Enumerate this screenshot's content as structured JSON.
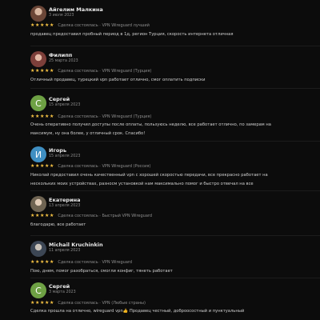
{
  "reviews": [
    {
      "name": "Айгелим Малкина",
      "date": "3 июля 2023",
      "avatar": {
        "type": "photo",
        "initial": "",
        "color": "#7a5a4a"
      },
      "rating": 5,
      "subtitle": "Сделка состоялась · VPN Wireguard лучший",
      "text": "продавец предоставил пробный период в 1д, регион Турция, скорость интернета отличная"
    },
    {
      "name": "Филипп",
      "date": "25 марта 2023",
      "avatar": {
        "type": "photo",
        "initial": "",
        "color": "#8a5a54"
      },
      "rating": 5,
      "subtitle": "Сделка состоялась · VPN Wireguard (Турция)",
      "text": "Отличный продавец, турецкий vpn работает отлично, смог оплатить подписки"
    },
    {
      "name": "Сергей",
      "date": "15 апреля 2023",
      "avatar": {
        "type": "letter",
        "initial": "С",
        "color": "#6ea144"
      },
      "rating": 5,
      "subtitle": "Сделка состоялась · VPN Wireguard (Турция)",
      "text": "Очень оперативно получил доступы после оплаты, пользуюсь неделю, все работает отлично, по замерам на максимум, ну она более, у отличный срок. Спасибо!"
    },
    {
      "name": "Игорь",
      "date": "15 апреля 2023",
      "avatar": {
        "type": "letter",
        "initial": "И",
        "color": "#3f8fc2"
      },
      "rating": 5,
      "subtitle": "Сделка состоялась · VPN Wireguard (Россия)",
      "text": "Николай предоставил очень качественный vpn с хорошей скоростью передачи, все прекрасно работает на нескольких моих устройствах, разносм установкой нам максимально помог и быстро отвечал на все"
    },
    {
      "name": "Екатерина",
      "date": "13 апреля 2023",
      "avatar": {
        "type": "photo",
        "initial": "",
        "color": "#8b7d6b"
      },
      "rating": 5,
      "subtitle": "Сделка состоялась · Быстрый VPN Wireguard",
      "text": "благодарю, все работает"
    },
    {
      "name": "Michail Kruchinkin",
      "date": "11 апреля 2023",
      "avatar": {
        "type": "photo",
        "initial": "",
        "color": "#5c6a7a"
      },
      "rating": 5,
      "subtitle": "Сделка состоялась · VPN Wireguard",
      "text": "Пою, днем, помог разобраться, смогли конфиг, тянеть работает"
    },
    {
      "name": "Сергей",
      "date": "3 марта 2023",
      "avatar": {
        "type": "letter",
        "initial": "С",
        "color": "#6ea144"
      },
      "rating": 5,
      "subtitle": "Сделка состоялась · VPN (Любые страны)",
      "text": "Сделка прошла на отлично, wireguard vpn👍 Продавец честный, доброосостный и пунктуальный"
    }
  ]
}
